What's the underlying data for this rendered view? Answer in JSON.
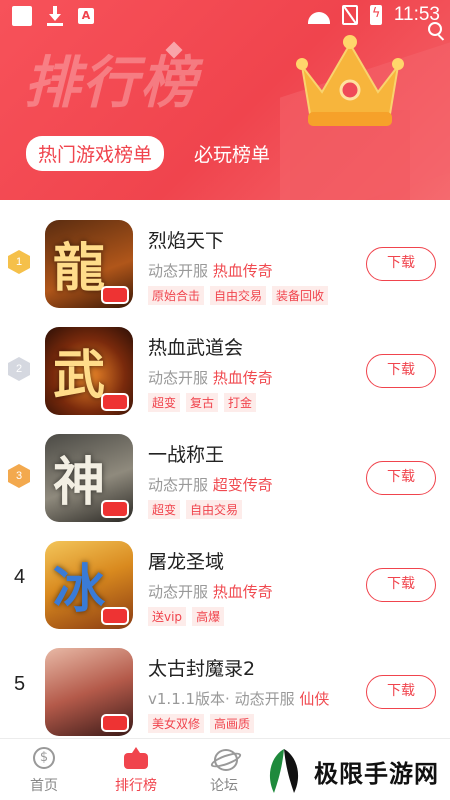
{
  "status_bar": {
    "time": "11:53",
    "a_badge": "A"
  },
  "header": {
    "title": "排行榜",
    "tabs": [
      {
        "label": "热门游戏榜单",
        "active": true
      },
      {
        "label": "必玩榜单",
        "active": false
      }
    ]
  },
  "games": [
    {
      "rank": "1",
      "rank_style": "gold",
      "name": "烈焰天下",
      "meta_prefix": "动态开服 ",
      "genre": "热血传奇",
      "tags": [
        "原始合击",
        "自由交易",
        "装备回收"
      ],
      "icon_glyph": "龍",
      "download_label": "下载"
    },
    {
      "rank": "2",
      "rank_style": "silver",
      "name": "热血武道会",
      "meta_prefix": "动态开服 ",
      "genre": "热血传奇",
      "tags": [
        "超变",
        "复古",
        "打金"
      ],
      "icon_glyph": "武",
      "download_label": "下载"
    },
    {
      "rank": "3",
      "rank_style": "bronze",
      "name": "一战称王",
      "meta_prefix": "动态开服 ",
      "genre": "超变传奇",
      "tags": [
        "超变",
        "自由交易"
      ],
      "icon_glyph": "神",
      "download_label": "下载"
    },
    {
      "rank": "4",
      "rank_style": "plain",
      "name": "屠龙圣域",
      "meta_prefix": "动态开服 ",
      "genre": "热血传奇",
      "tags": [
        "送vip",
        "高爆"
      ],
      "icon_glyph": "冰",
      "download_label": "下载"
    },
    {
      "rank": "5",
      "rank_style": "plain",
      "name": "太古封魔录2",
      "meta_prefix": "v1.1.1版本· 动态开服 ",
      "genre": "仙侠",
      "tags": [
        "美女双修",
        "高画质"
      ],
      "icon_glyph": "",
      "download_label": "下载"
    }
  ],
  "bottom_nav": [
    {
      "label": "首页",
      "icon": "home-icon",
      "active": false
    },
    {
      "label": "排行榜",
      "icon": "rank-icon",
      "active": true
    },
    {
      "label": "论坛",
      "icon": "forum-icon",
      "active": false
    }
  ],
  "watermark": {
    "text": "极限手游网"
  },
  "colors": {
    "accent": "#f0444d",
    "gold": "#f5c04a",
    "silver": "#d5d8e0",
    "bronze": "#f3a94e",
    "chip_bg": "#fdecea"
  }
}
